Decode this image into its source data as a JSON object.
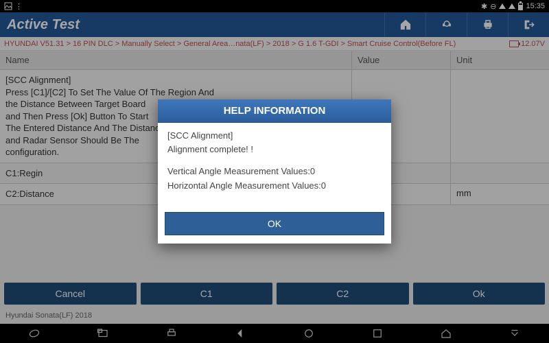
{
  "statusbar": {
    "time": "15:35"
  },
  "header": {
    "title": "Active Test"
  },
  "breadcrumb": {
    "path": "HYUNDAI V51.31 > 16 PIN DLC > Manually Select > General Area…nata(LF) > 2018 > G 1.6 T-GDI > Smart Cruise Control(Before FL)",
    "voltage": "12.07V"
  },
  "table": {
    "headers": {
      "name": "Name",
      "value": "Value",
      "unit": "Unit"
    },
    "rows": [
      {
        "name": "[SCC Alignment]\nPress [C1]/[C2] To Set The Value Of The Region And\nthe Distance Between Target Board\nand Then Press [Ok] Button To Start\nThe Entered Distance And The Distance\nand Radar Sensor Should Be The\nconfiguration.",
        "value": "",
        "unit": ""
      },
      {
        "name": "C1:Regin",
        "value": "",
        "unit": ""
      },
      {
        "name": "C2:Distance",
        "value": "",
        "unit": "mm"
      }
    ]
  },
  "actions": [
    "Cancel",
    "C1",
    "C2",
    "Ok"
  ],
  "footer": {
    "vehicle": "Hyundai Sonata(LF) 2018"
  },
  "modal": {
    "title": "HELP INFORMATION",
    "lines": [
      "[SCC Alignment]",
      "Alignment complete! !",
      "Vertical Angle Measurement Values:0",
      "Horizontal Angle Measurement Values:0"
    ],
    "ok": "OK"
  }
}
